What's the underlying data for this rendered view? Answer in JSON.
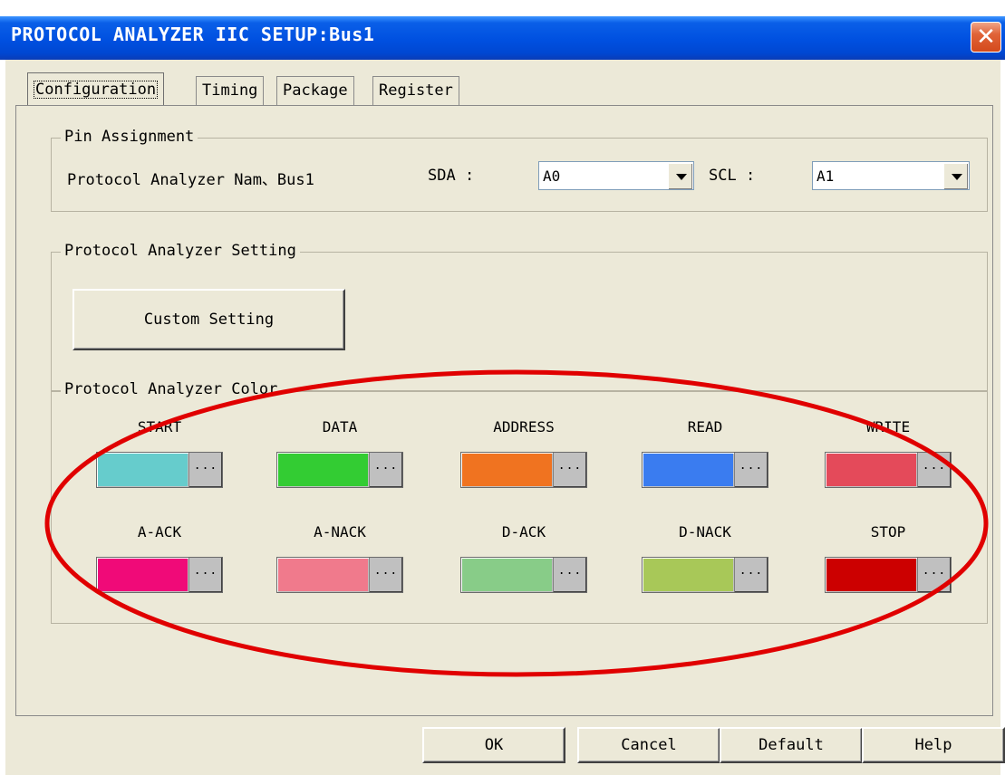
{
  "window": {
    "title": "PROTOCOL ANALYZER IIC SETUP:Bus1",
    "close_glyph": "✕"
  },
  "tabs": [
    {
      "label": "Configuration",
      "active": true
    },
    {
      "label": "Timing",
      "active": false
    },
    {
      "label": "Package",
      "active": false
    },
    {
      "label": "Register",
      "active": false
    }
  ],
  "pin_assignment": {
    "title": "Pin Assignment",
    "name_label": "Protocol Analyzer Nam、Bus1",
    "sda_label": "SDA :",
    "sda_value": "A0",
    "scl_label": "SCL :",
    "scl_value": "A1"
  },
  "setting": {
    "title": "Protocol Analyzer Setting",
    "custom_button": "Custom Setting"
  },
  "color_group": {
    "title": "Protocol Analyzer Color",
    "more_glyph": "...",
    "items": [
      {
        "label": "START",
        "color": "#66cccc"
      },
      {
        "label": "DATA",
        "color": "#33cc33"
      },
      {
        "label": "ADDRESS",
        "color": "#f07320"
      },
      {
        "label": "READ",
        "color": "#3a7cf0"
      },
      {
        "label": "WRITE",
        "color": "#e44a5a"
      },
      {
        "label": "A-ACK",
        "color": "#f00a78"
      },
      {
        "label": "A-NACK",
        "color": "#f07a8c"
      },
      {
        "label": "D-ACK",
        "color": "#88cc88"
      },
      {
        "label": "D-NACK",
        "color": "#a8c858"
      },
      {
        "label": "STOP",
        "color": "#cc0000"
      }
    ]
  },
  "buttons": {
    "ok": "OK",
    "cancel": "Cancel",
    "default": "Default",
    "help": "Help"
  },
  "colors": {
    "title_bar": "#0050e0",
    "annotation_ellipse": "#e00000",
    "face": "#ece9d8"
  }
}
